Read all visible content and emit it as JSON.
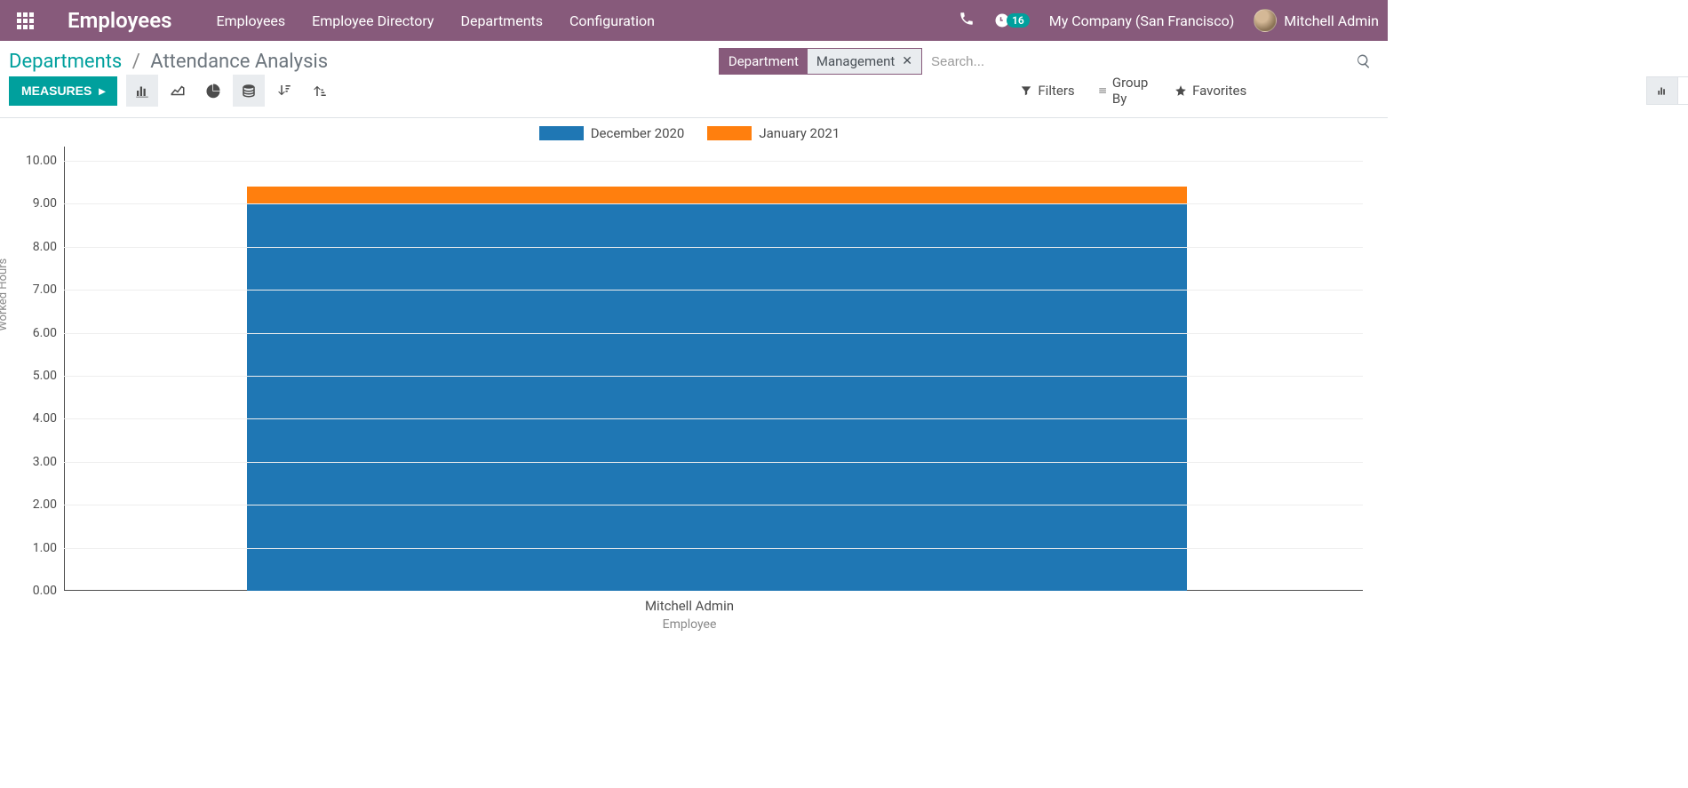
{
  "topnav": {
    "brand": "Employees",
    "menus": [
      "Employees",
      "Employee Directory",
      "Departments",
      "Configuration"
    ],
    "activity_count": "16",
    "company": "My Company (San Francisco)",
    "user": "Mitchell Admin"
  },
  "breadcrumb": {
    "parent": "Departments",
    "current": "Attendance Analysis"
  },
  "search": {
    "facet_label": "Department",
    "facet_value": "Management",
    "placeholder": "Search..."
  },
  "controls": {
    "measures_label": "MEASURES",
    "filters": "Filters",
    "group_by": "Group By",
    "favorites": "Favorites"
  },
  "chart_data": {
    "type": "bar",
    "stacked": true,
    "categories": [
      "Mitchell Admin"
    ],
    "series": [
      {
        "name": "December 2020",
        "values": [
          9.0
        ],
        "color": "#1f77b4"
      },
      {
        "name": "January 2021",
        "values": [
          0.4
        ],
        "color": "#ff7f0e"
      }
    ],
    "yticks": [
      "0.00",
      "1.00",
      "2.00",
      "3.00",
      "4.00",
      "5.00",
      "6.00",
      "7.00",
      "8.00",
      "9.00",
      "10.00"
    ],
    "ylim": [
      0,
      10
    ],
    "ylabel": "Worked Hours",
    "xlabel": "Employee"
  }
}
